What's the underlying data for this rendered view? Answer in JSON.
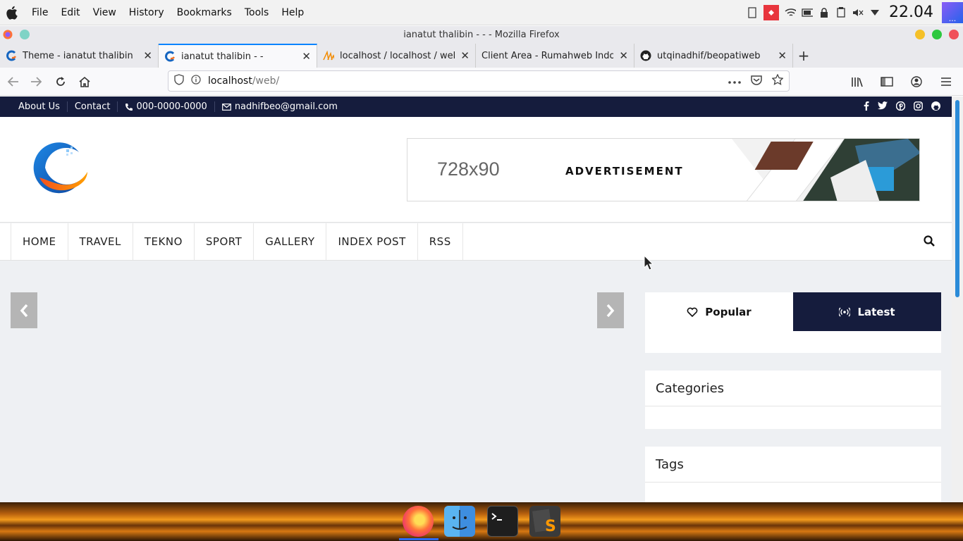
{
  "os_menubar": {
    "items": [
      "File",
      "Edit",
      "View",
      "History",
      "Bookmarks",
      "Tools",
      "Help"
    ],
    "clock": "22.04",
    "launcher_label": "..."
  },
  "window": {
    "title": "ianatut thalibin - - - Mozilla Firefox"
  },
  "tabs": [
    {
      "label": "Theme - ianatut thalibin",
      "icon": "site-c-icon",
      "active": false
    },
    {
      "label": "ianatut thalibin - -",
      "icon": "site-c-icon",
      "active": true
    },
    {
      "label": "localhost / localhost / web",
      "icon": "phpmyadmin-icon",
      "active": false
    },
    {
      "label": "Client Area - Rumahweb Indonesia",
      "icon": "",
      "active": false
    },
    {
      "label": "utqinadhif/beopatiweb",
      "icon": "github-icon",
      "active": false
    }
  ],
  "urlbar": {
    "host": "localhost",
    "path": "/web/"
  },
  "site": {
    "topbar": {
      "about": "About Us",
      "contact": "Contact",
      "phone": "000-0000-0000",
      "email": "nadhifbeo@gmail.com"
    },
    "ad": {
      "size_text": "728x90",
      "label": "ADVERTISEMENT"
    },
    "nav": [
      "HOME",
      "TRAVEL",
      "TEKNO",
      "SPORT",
      "GALLERY",
      "INDEX POST",
      "RSS"
    ],
    "sidebar": {
      "tab_popular": "Popular",
      "tab_latest": "Latest",
      "categories_title": "Categories",
      "tags_title": "Tags"
    }
  },
  "colors": {
    "brand_navy": "#151c3d",
    "accent_blue": "#0a84ff"
  }
}
